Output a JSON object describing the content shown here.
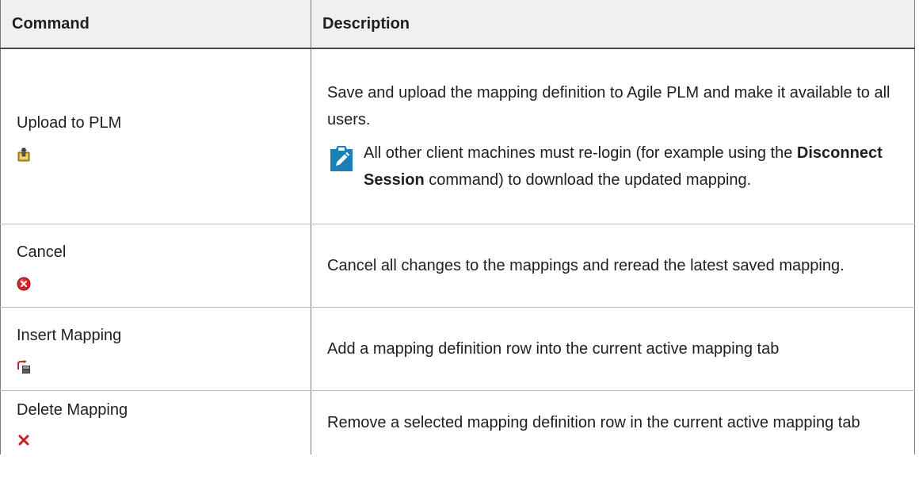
{
  "table": {
    "headers": {
      "command": "Command",
      "description": "Description"
    },
    "rows": [
      {
        "command": "Upload to PLM",
        "icon": "upload-to-plm-icon",
        "description": "Save and upload the mapping definition to Agile PLM and make it available to all users.",
        "note": {
          "icon": "note-pencil-icon",
          "before": "All other client machines must re-login (for example using the ",
          "bold": "Disconnect Session",
          "after": " command) to download the updated mapping."
        }
      },
      {
        "command": "Cancel",
        "icon": "cancel-circle-icon",
        "description": "Cancel all changes to the mappings and reread the latest saved mapping."
      },
      {
        "command": "Insert Mapping",
        "icon": "insert-mapping-icon",
        "description": "Add a mapping definition row into the current active mapping tab"
      },
      {
        "command": "Delete Mapping",
        "icon": "delete-x-icon",
        "description": "Remove a selected mapping definition row in the current active mapping tab"
      }
    ]
  },
  "colors": {
    "header_bg": "#f0f0f0",
    "note_icon_bg": "#1a7fb5",
    "cancel_red": "#d8232a",
    "delete_red": "#cc1f1f"
  }
}
